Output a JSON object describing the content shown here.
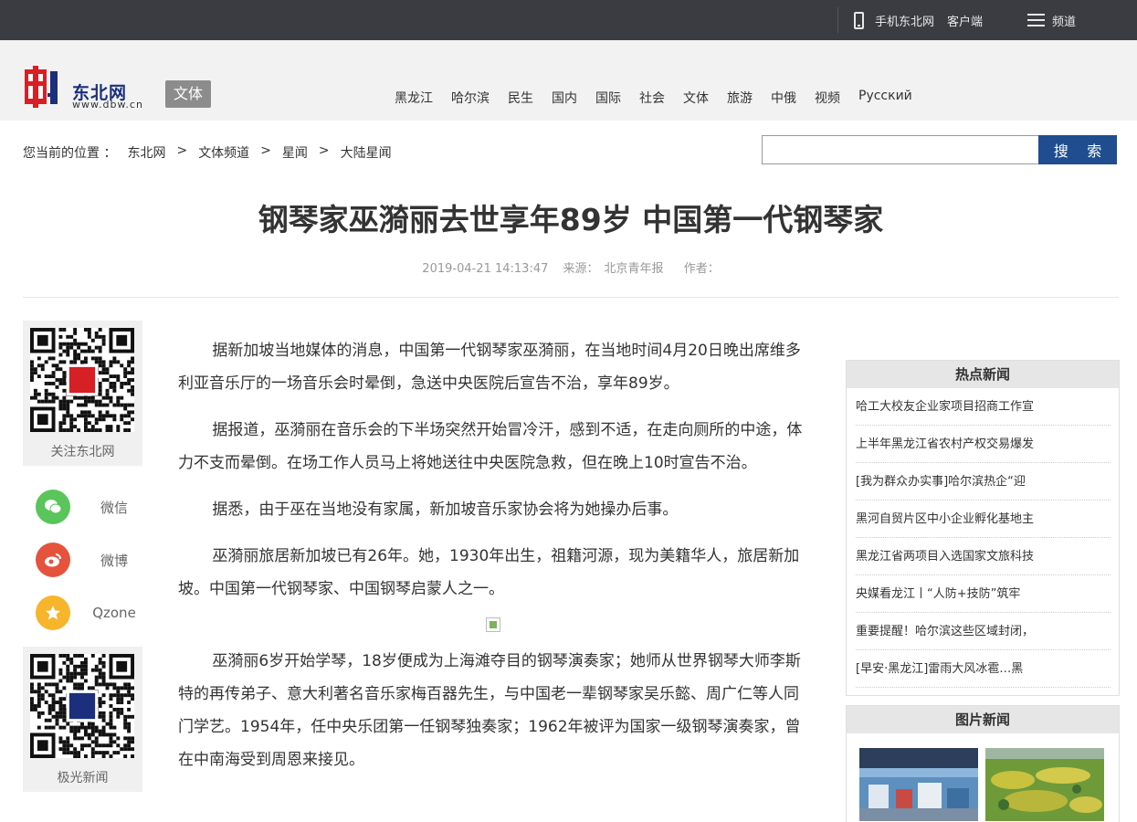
{
  "topbar": {
    "mobile_label": "手机东北网",
    "client_label": "客户端",
    "channel_label": "频道"
  },
  "brand": {
    "name": "东北网",
    "url": "www.dbw.cn",
    "channel_tag": "文体",
    "accent": "#d71f26"
  },
  "nav": [
    "黑龙江",
    "哈尔滨",
    "民生",
    "国内",
    "国际",
    "社会",
    "文体",
    "旅游",
    "中俄",
    "视频",
    "Русский"
  ],
  "breadcrumb": {
    "prefix": "您当前的位置 ：",
    "sep": ">",
    "items": [
      "东北网",
      "文体频道",
      "星闻",
      "大陆星闻"
    ]
  },
  "search": {
    "placeholder": "",
    "button": "搜 索"
  },
  "article": {
    "title": "钢琴家巫漪丽去世享年89岁 中国第一代钢琴家",
    "datetime": "2019-04-21 14:13:47",
    "source_label": "来源：",
    "source": "北京青年报",
    "author_label": "作者："
  },
  "paragraphs": [
    "据新加坡当地媒体的消息，中国第一代钢琴家巫漪丽，在当地时间4月20日晚出席维多利亚音乐厅的一场音乐会时晕倒，急送中央医院后宣告不治，享年89岁。",
    "据报道，巫漪丽在音乐会的下半场突然开始冒冷汗，感到不适，在走向厕所的中途，体力不支而晕倒。在场工作人员马上将她送往中央医院急救，但在晚上10时宣告不治。",
    "据悉，由于巫在当地没有家属，新加坡音乐家协会将为她操办后事。",
    "巫漪丽旅居新加坡已有26年。她，1930年出生，祖籍河源，现为美籍华人，旅居新加坡。中国第一代钢琴家、中国钢琴启蒙人之一。",
    "巫漪丽6岁开始学琴，18岁便成为上海滩夺目的钢琴演奏家；她师从世界钢琴大师李斯特的再传弟子、意大利著名音乐家梅百器先生，与中国老一辈钢琴家吴乐懿、周广仁等人同门学艺。1954年，任中央乐团第一任钢琴独奏家；1962年被评为国家一级钢琴演奏家，曾在中南海受到周恩来接见。"
  ],
  "share": {
    "follow_caption": "关注东北网",
    "items": [
      {
        "label": "微信",
        "icon": "wechat-icon",
        "color": "#5ac55a"
      },
      {
        "label": "微博",
        "icon": "weibo-icon",
        "color": "#e5533d"
      },
      {
        "label": "Qzone",
        "icon": "qzone-icon",
        "color": "#f7b52c"
      }
    ],
    "aurora_caption": "极光新闻"
  },
  "hot_news": {
    "title": "热点新闻",
    "items": [
      "哈工大校友企业家项目招商工作宣",
      "上半年黑龙江省农村产权交易爆发",
      "[我为群众办实事]哈尔滨热企“迎",
      "黑河自贸片区中小企业孵化基地主",
      "黑龙江省两项目入选国家文旅科技",
      "央媒看龙江丨“人防+技防”筑牢",
      "重要提醒！哈尔滨这些区域封闭，",
      "[早安·黑龙江]雷雨大风冰雹…黑"
    ]
  },
  "photo_news": {
    "title": "图片新闻"
  }
}
